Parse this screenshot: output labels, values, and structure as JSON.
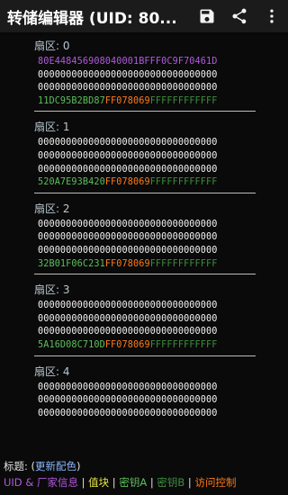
{
  "appbar": {
    "title": "转储编辑器 (UID: 80...",
    "icons": [
      "save-icon",
      "share-icon",
      "more-vert-icon"
    ]
  },
  "sectors": [
    {
      "label": "扇区: 0",
      "lines": [
        [
          {
            "t": "80E448456908040001BFFF0C9F70461D",
            "c": "uid"
          }
        ],
        [
          {
            "t": "00000000000000000000000000000000",
            "c": "white"
          }
        ],
        [
          {
            "t": "00000000000000000000000000000000",
            "c": "white"
          }
        ],
        [
          {
            "t": "11DC95B2BD87",
            "c": "key-a"
          },
          {
            "t": "FF078069",
            "c": "access"
          },
          {
            "t": "FFFFFFFFFFFF",
            "c": "key-b"
          }
        ]
      ]
    },
    {
      "label": "扇区: 1",
      "lines": [
        [
          {
            "t": "00000000000000000000000000000000",
            "c": "white"
          }
        ],
        [
          {
            "t": "00000000000000000000000000000000",
            "c": "white"
          }
        ],
        [
          {
            "t": "00000000000000000000000000000000",
            "c": "white"
          }
        ],
        [
          {
            "t": "520A7E93B420",
            "c": "key-a"
          },
          {
            "t": "FF078069",
            "c": "access"
          },
          {
            "t": "FFFFFFFFFFFF",
            "c": "key-b"
          }
        ]
      ]
    },
    {
      "label": "扇区: 2",
      "lines": [
        [
          {
            "t": "00000000000000000000000000000000",
            "c": "white"
          }
        ],
        [
          {
            "t": "00000000000000000000000000000000",
            "c": "white"
          }
        ],
        [
          {
            "t": "00000000000000000000000000000000",
            "c": "white"
          }
        ],
        [
          {
            "t": "32B01F06C231",
            "c": "key-a"
          },
          {
            "t": "FF078069",
            "c": "access"
          },
          {
            "t": "FFFFFFFFFFFF",
            "c": "key-b"
          }
        ]
      ]
    },
    {
      "label": "扇区: 3",
      "lines": [
        [
          {
            "t": "00000000000000000000000000000000",
            "c": "white"
          }
        ],
        [
          {
            "t": "00000000000000000000000000000000",
            "c": "white"
          }
        ],
        [
          {
            "t": "00000000000000000000000000000000",
            "c": "white"
          }
        ],
        [
          {
            "t": "5A16D08C710D",
            "c": "key-a"
          },
          {
            "t": "FF078069",
            "c": "access"
          },
          {
            "t": "FFFFFFFFFFFF",
            "c": "key-b"
          }
        ]
      ]
    },
    {
      "label": "扇区: 4",
      "lines": [
        [
          {
            "t": "00000000000000000000000000000000",
            "c": "white"
          }
        ],
        [
          {
            "t": "00000000000000000000000000000000",
            "c": "white"
          }
        ],
        [
          {
            "t": "00000000000000000000000000000000",
            "c": "white"
          }
        ]
      ]
    }
  ],
  "legend": {
    "title_prefix": "标题: (",
    "title_link": "更新配色",
    "title_suffix": ")",
    "items": [
      {
        "text": "UID & 厂家信息",
        "color": "#b259e0"
      },
      {
        "text": "值块",
        "color": "#e8e84a"
      },
      {
        "text": "密钥A",
        "color": "#5cbf5c"
      },
      {
        "text": "密钥B",
        "color": "#3e8e3e"
      },
      {
        "text": "访问控制",
        "color": "#ff7a1a"
      }
    ],
    "separator": " | "
  }
}
